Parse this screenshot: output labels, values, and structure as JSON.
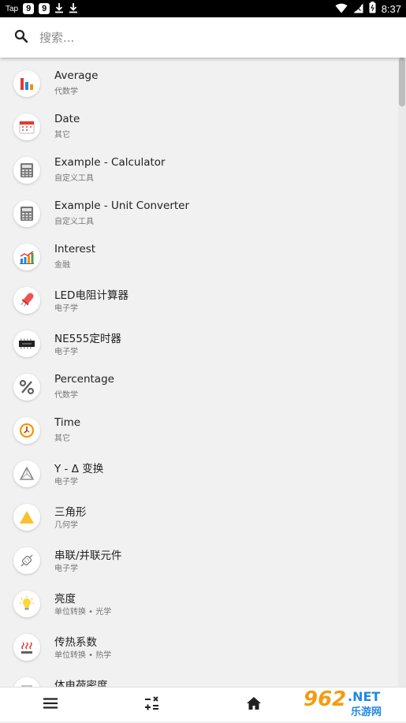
{
  "status_bar": {
    "carrier": "Tap",
    "badges": [
      "9",
      "9"
    ],
    "time": "8:37",
    "icons": [
      "download-icon",
      "download-icon",
      "wifi-icon",
      "signal-icon",
      "battery-icon"
    ]
  },
  "search": {
    "placeholder": "搜索..."
  },
  "list": {
    "items": [
      {
        "title": "Average",
        "subtitle": "代数学",
        "icon": "bar-chart-icon"
      },
      {
        "title": "Date",
        "subtitle": "其它",
        "icon": "calendar-icon"
      },
      {
        "title": "Example - Calculator",
        "subtitle": "自定义工具",
        "icon": "calculator-icon"
      },
      {
        "title": "Example - Unit Converter",
        "subtitle": "自定义工具",
        "icon": "calculator-icon"
      },
      {
        "title": "Interest",
        "subtitle": "金融",
        "icon": "growth-chart-icon"
      },
      {
        "title": "LED电阻计算器",
        "subtitle": "电子学",
        "icon": "led-icon"
      },
      {
        "title": "NE555定时器",
        "subtitle": "电子学",
        "icon": "chip-icon"
      },
      {
        "title": "Percentage",
        "subtitle": "代数学",
        "icon": "percent-icon"
      },
      {
        "title": "Time",
        "subtitle": "其它",
        "icon": "clock-icon"
      },
      {
        "title": "Y - Δ 变换",
        "subtitle": "电子学",
        "icon": "triangle-network-icon"
      },
      {
        "title": "三角形",
        "subtitle": "几何学",
        "icon": "triangle-icon"
      },
      {
        "title": "串联/并联元件",
        "subtitle": "电子学",
        "icon": "component-icon"
      },
      {
        "title": "亮度",
        "subtitle": "单位转换 • 光学",
        "icon": "lightbulb-icon"
      },
      {
        "title": "传热系数",
        "subtitle": "单位转换 • 热学",
        "icon": "heat-icon"
      },
      {
        "title": "体电荷密度",
        "subtitle": "",
        "icon": "charge-icon"
      }
    ]
  },
  "bottom_nav": {
    "items": [
      "menu-icon",
      "calculator-ops-icon",
      "home-icon"
    ]
  },
  "watermark": {
    "brand": "962",
    "suffix": ".NET",
    "chinese": "乐游网"
  },
  "colors": {
    "status_bar": "#000000",
    "background": "#f1f1f1",
    "search_bar": "#ffffff",
    "title_text": "#212121",
    "subtitle_text": "#757575",
    "watermark_orange": "#f39c12",
    "watermark_blue": "#1e88e5"
  }
}
